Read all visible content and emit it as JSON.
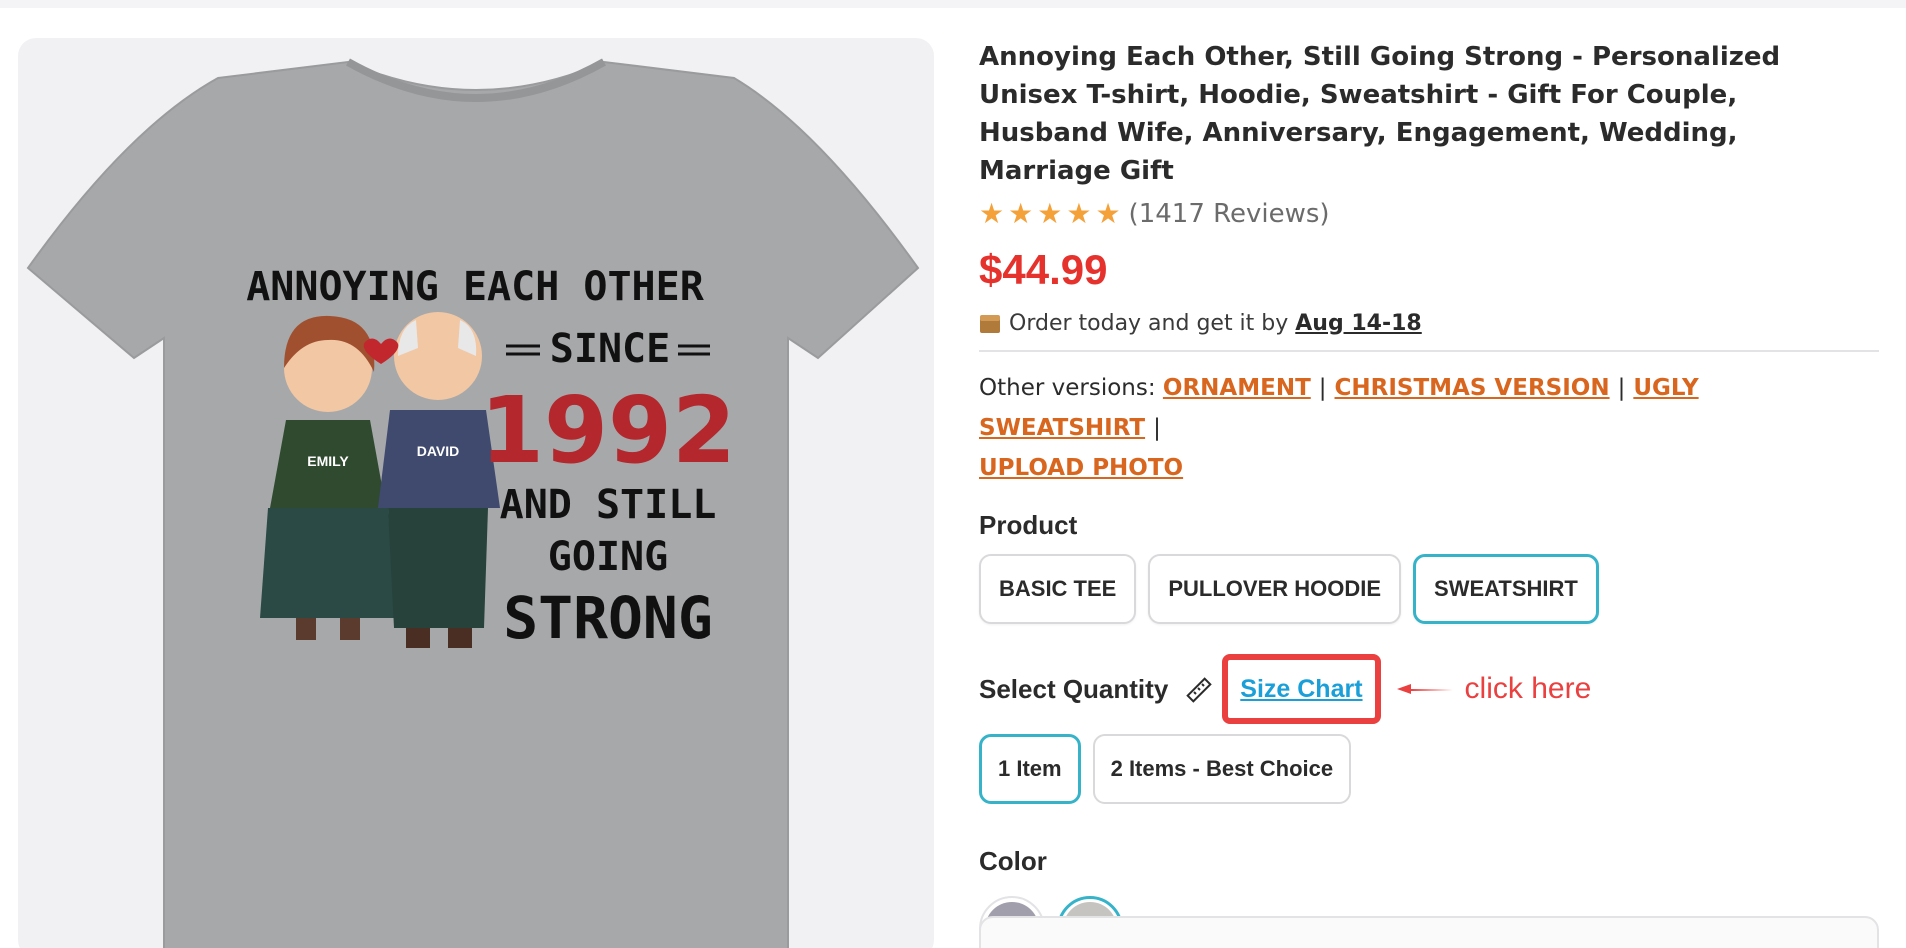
{
  "product": {
    "title": "Annoying Each Other, Still Going Strong - Personalized Unisex T-shirt, Hoodie, Sweatshirt - Gift For Couple, Husband Wife, Anniversary, Engagement, Wedding, Marriage Gift",
    "rating_stars": 5,
    "reviews_text": "(1417 Reviews)",
    "price": "$44.99",
    "delivery_text": "Order today and get it by",
    "delivery_date": "Aug 14-18"
  },
  "versions": {
    "label": "Other versions:",
    "links": [
      "ORNAMENT",
      "CHRISTMAS VERSION",
      "UGLY SWEATSHIRT",
      "UPLOAD PHOTO"
    ],
    "separator": "|"
  },
  "product_types": {
    "label": "Product",
    "options": [
      "BASIC TEE",
      "PULLOVER HOODIE",
      "SWEATSHIRT"
    ],
    "selected": "SWEATSHIRT"
  },
  "quantity": {
    "label": "Select Quantity",
    "size_chart_label": "Size Chart",
    "annotation": "click here",
    "options": [
      "1 Item",
      "2 Items - Best Choice"
    ],
    "selected": "1 Item"
  },
  "color": {
    "label": "Color",
    "swatches": [
      "#a09fab",
      "#c6c4c0"
    ],
    "selected_index": 1
  },
  "image": {
    "headline_line1": "ANNOYING EACH OTHER",
    "headline_line2": "SINCE",
    "year": "1992",
    "line4": "AND STILL",
    "line5": "GOING",
    "line6": "STRONG",
    "name_left": "EMILY",
    "name_right": "DAVID"
  },
  "colors": {
    "accent_teal": "#36b3c8",
    "price_red": "#e5322d",
    "link_orange": "#d9661f",
    "size_chart_blue": "#1a9fd8",
    "annotation_red": "#ea4040",
    "star_orange": "#f4a13a"
  },
  "icons": {
    "star": "star-icon",
    "box": "package-icon",
    "ruler": "ruler-icon",
    "arrow": "arrow-left-icon"
  }
}
